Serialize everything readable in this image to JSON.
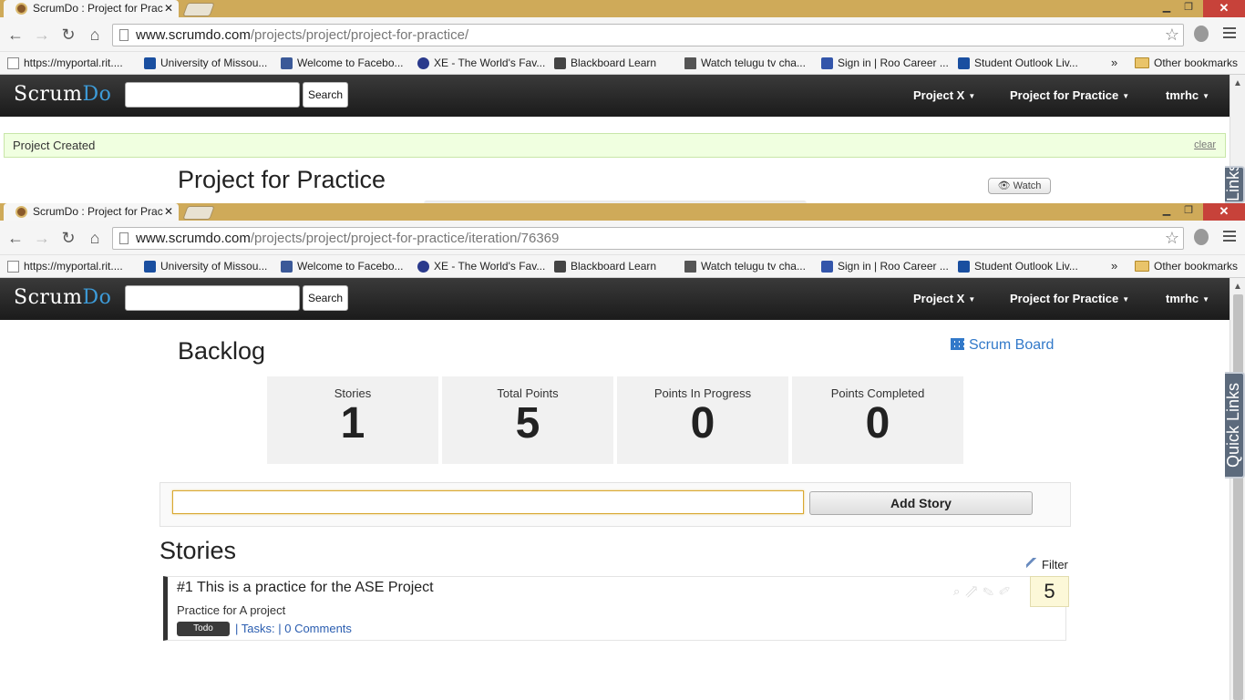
{
  "window1": {
    "tab_title": "ScrumDo : Project for Prac",
    "url_host": "www.scrumdo.com",
    "url_path": "/projects/project/project-for-practice/",
    "flash_message": "Project Created",
    "flash_clear": "clear",
    "page_title": "Project for Practice",
    "watch_label": "Watch",
    "quick_links": "Links"
  },
  "window2": {
    "tab_title": "ScrumDo : Project for Prac",
    "url_host": "www.scrumdo.com",
    "url_path": "/projects/project/project-for-practice/iteration/76369",
    "quick_links": "Quick Links"
  },
  "bookmarks": [
    {
      "label": "https://myportal.rit....",
      "icon": "page-icon",
      "color": "#cccccc"
    },
    {
      "label": "University of Missou...",
      "icon": "university-icon",
      "color": "#1a4fa0"
    },
    {
      "label": "Welcome to Facebo...",
      "icon": "facebook-icon",
      "color": "#3b5998"
    },
    {
      "label": "XE - The World's Fav...",
      "icon": "xe-icon",
      "color": "#2a3a8c"
    },
    {
      "label": "Blackboard Learn",
      "icon": "blackboard-icon",
      "color": "#444444"
    },
    {
      "label": "Watch telugu tv cha...",
      "icon": "tv-icon",
      "color": "#555555"
    },
    {
      "label": "Sign in | Roo Career ...",
      "icon": "roo-icon",
      "color": "#3355aa"
    },
    {
      "label": "Student Outlook Liv...",
      "icon": "outlook-icon",
      "color": "#1a4fa0"
    }
  ],
  "bookmarks_other": "Other bookmarks",
  "bookmarks_more": "»",
  "header": {
    "logo_main": "Scrum",
    "logo_accent": "Do",
    "search_button": "Search",
    "nav": [
      "Project X",
      "Project for Practice",
      "tmrhc"
    ]
  },
  "backlog": {
    "heading": "Backlog",
    "scrum_board_link": "Scrum Board",
    "stats": [
      {
        "label": "Stories",
        "value": "1"
      },
      {
        "label": "Total Points",
        "value": "5"
      },
      {
        "label": "Points In Progress",
        "value": "0"
      },
      {
        "label": "Points Completed",
        "value": "0"
      }
    ],
    "add_story_button": "Add Story"
  },
  "stories": {
    "heading": "Stories",
    "filter_label": "Filter",
    "items": [
      {
        "title": "#1 This is a practice for the ASE Project",
        "description": "Practice for A project",
        "status": "Todo",
        "tasks_link": "| Tasks:",
        "comments_link": "| 0 Comments",
        "points": "5"
      }
    ]
  },
  "colors": {
    "accent": "#3d9bd8",
    "link": "#3279c9",
    "chrome_frame": "#cfaa59",
    "close_red": "#c7423a"
  }
}
